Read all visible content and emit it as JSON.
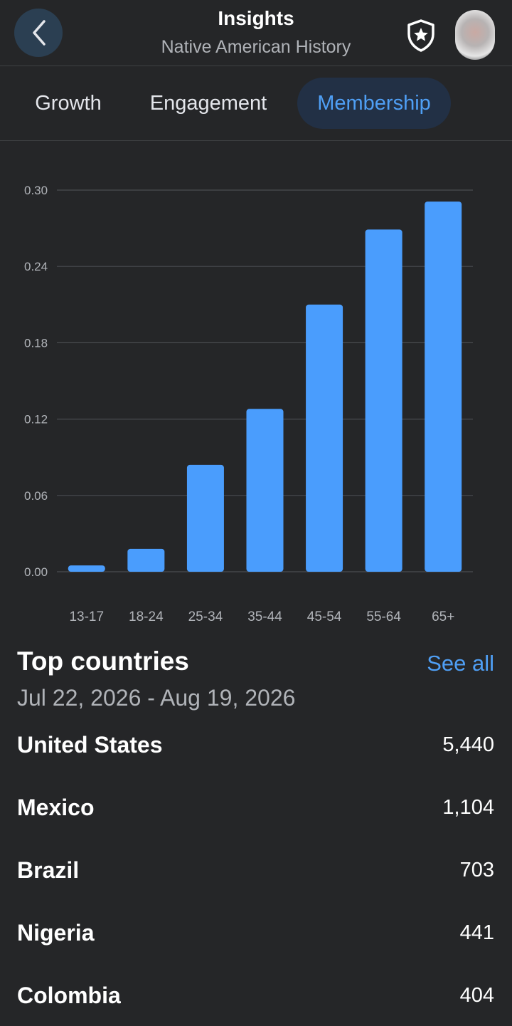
{
  "header": {
    "title": "Insights",
    "subtitle": "Native American History"
  },
  "icons": {
    "back": "chevron-left-icon",
    "admin": "shield-star-icon",
    "avatar": "profile-avatar"
  },
  "tabs": [
    {
      "label": "Growth",
      "active": false
    },
    {
      "label": "Engagement",
      "active": false
    },
    {
      "label": "Membership",
      "active": true
    }
  ],
  "colors": {
    "accent": "#4f9ff5",
    "bar": "#4a9dfd",
    "background": "#252628"
  },
  "chart_data": {
    "type": "bar",
    "categories": [
      "13-17",
      "18-24",
      "25-34",
      "35-44",
      "45-54",
      "55-64",
      "65+"
    ],
    "values": [
      0.005,
      0.018,
      0.084,
      0.128,
      0.21,
      0.269,
      0.291
    ],
    "yticks": [
      "0.00",
      "0.06",
      "0.12",
      "0.18",
      "0.24",
      "0.30"
    ],
    "ylim": [
      0,
      0.3
    ],
    "grid": true
  },
  "countries": {
    "title": "Top countries",
    "see_all": "See all",
    "date_range": "Jul 22, 2026 - Aug 19, 2026",
    "rows": [
      {
        "name": "United States",
        "value": "5,440"
      },
      {
        "name": "Mexico",
        "value": "1,104"
      },
      {
        "name": "Brazil",
        "value": "703"
      },
      {
        "name": "Nigeria",
        "value": "441"
      },
      {
        "name": "Colombia",
        "value": "404"
      }
    ]
  }
}
